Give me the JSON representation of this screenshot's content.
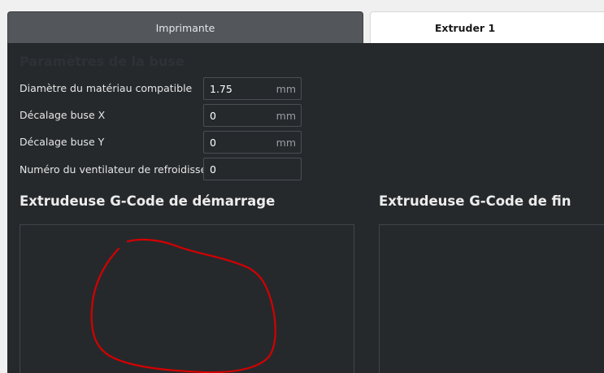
{
  "tabs": [
    {
      "label": "Imprimante",
      "active": false
    },
    {
      "label": "Extruder 1",
      "active": true
    }
  ],
  "nozzle_section": {
    "title": "Paramètres de la buse"
  },
  "settings": {
    "material_diameter": {
      "label": "Diamètre du matériau compatible",
      "value": "1.75",
      "unit": "mm"
    },
    "offset_x": {
      "label": "Décalage buse X",
      "value": "0",
      "unit": "mm"
    },
    "offset_y": {
      "label": "Décalage buse Y",
      "value": "0",
      "unit": "mm"
    },
    "cooling_fan": {
      "label": "Numéro du ventilateur de refroidissement",
      "value": "0"
    }
  },
  "gcode": {
    "start_title": "Extrudeuse G-Code de démarrage",
    "end_title": "Extrudeuse G-Code de fin"
  },
  "colors": {
    "panel_background": "#26292c",
    "annotation_stroke": "#d40000",
    "active_tab": "#ffffff",
    "inactive_tab": "#53575c"
  }
}
